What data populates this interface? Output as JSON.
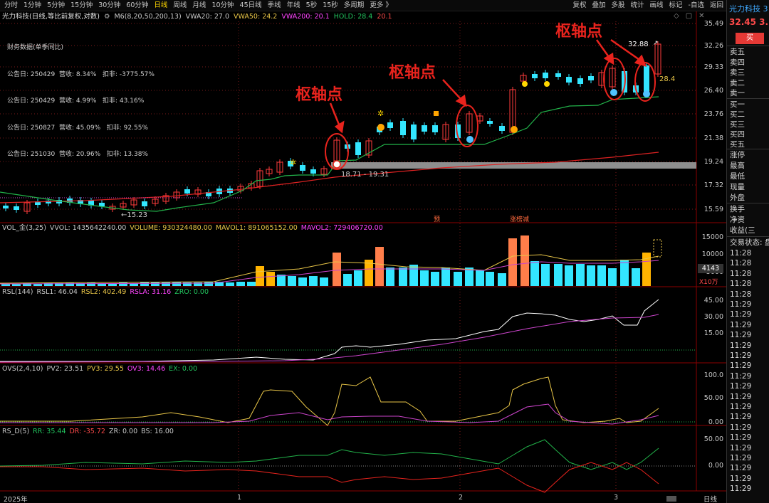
{
  "topbar": {
    "periods": [
      "分时",
      "1分钟",
      "5分钟",
      "15分钟",
      "30分钟",
      "60分钟",
      "日线",
      "周线",
      "月线",
      "10分钟",
      "45日线",
      "季线",
      "年线",
      "5秒",
      "15秒",
      "多周期",
      "更多"
    ],
    "active_period": "日线",
    "tools": [
      "复权",
      "叠加",
      "多股",
      "统计",
      "画线",
      "标记",
      "-自选",
      "返回"
    ]
  },
  "main": {
    "title": "光力科技(日线,等比前复权,对数)",
    "indicators": [
      {
        "label": "M6(8,20,50,200,13)",
        "color": "#c8c8c8"
      },
      {
        "label": "VWA20: 27.0",
        "color": "#c8c8c8"
      },
      {
        "label": "VWA50: 24.2",
        "color": "#e8c547"
      },
      {
        "label": "VWA200: 20.1",
        "color": "#ff44ff"
      },
      {
        "label": "HOLD: 28.4",
        "color": "#22c55e"
      },
      {
        "label": "20.1",
        "color": "#ff4a4a"
      }
    ],
    "financial_title": "财务数据(单季同比)",
    "financial_rows": [
      "公告日: 250429  营收: 8.34%   扣非: -3775.57%",
      "公告日: 250429  营收: 4.99%   扣非: 43.16%",
      "公告日: 250827  营收: 45.09%   扣非: 92.55%",
      "公告日: 251030  营收: 20.96%   扣非: 13.38%"
    ],
    "price_axis": [
      "35.49",
      "32.26",
      "29.33",
      "26.40",
      "23.76",
      "21.38",
      "19.24",
      "17.32",
      "15.59"
    ],
    "price_labels": {
      "low": "15.23",
      "high": "32.88",
      "hold_tag": "28.4",
      "band": "18.71 - 19.31"
    },
    "tags": {
      "yu": "预",
      "zhangting": "涨榜减"
    },
    "annotations": [
      "枢轴点",
      "枢轴点",
      "枢轴点"
    ],
    "x_axis": [
      "2025年",
      "1",
      "2",
      "3"
    ],
    "x_axis_right": "日线"
  },
  "volume": {
    "head": [
      {
        "label": "VOL_金(3,25)",
        "color": "#c8c8c8"
      },
      {
        "label": "VVOL: 1435642240.00",
        "color": "#c8c8c8"
      },
      {
        "label": "VOLUME: 930324480.00",
        "color": "#e8c547"
      },
      {
        "label": "MAVOL1: 891065152.00",
        "color": "#e8c547"
      },
      {
        "label": "MAVOL2: 729406720.00",
        "color": "#ff44ff"
      }
    ],
    "axis": [
      "15000",
      "10000",
      "5000"
    ],
    "current": "4143",
    "unit": "X10万"
  },
  "rsl": {
    "head": [
      {
        "label": "RSL(144)",
        "color": "#c8c8c8"
      },
      {
        "label": "RSL1: 46.04",
        "color": "#c8c8c8"
      },
      {
        "label": "RSL2: 402.49",
        "color": "#e8c547"
      },
      {
        "label": "RSLA: 31.16",
        "color": "#ff44ff"
      },
      {
        "label": "ZRO: 0.00",
        "color": "#22c55e"
      }
    ],
    "axis": [
      "45.00",
      "30.00",
      "15.00"
    ]
  },
  "ovs": {
    "head": [
      {
        "label": "OVS(2,4,10)",
        "color": "#c8c8c8"
      },
      {
        "label": "PV2: 23.51",
        "color": "#c8c8c8"
      },
      {
        "label": "PV3: 29.55",
        "color": "#e8c547"
      },
      {
        "label": "OV3: 14.46",
        "color": "#ff44ff"
      },
      {
        "label": "EX: 0.00",
        "color": "#22c55e"
      }
    ],
    "axis": [
      "100.0",
      "50.00",
      "0.00"
    ]
  },
  "rsd": {
    "head": [
      {
        "label": "RS_D(5)",
        "color": "#c8c8c8"
      },
      {
        "label": "RR: 35.44",
        "color": "#22c55e"
      },
      {
        "label": "DR: -35.72",
        "color": "#ff4a4a"
      },
      {
        "label": "ZR: 0.00",
        "color": "#c8c8c8"
      },
      {
        "label": "BS: 16.00",
        "color": "#c8c8c8"
      }
    ],
    "axis": [
      "50.00",
      "0.00"
    ]
  },
  "right_panel": {
    "name": "光力科技 3",
    "price": "32.45  3.1",
    "buy": "买",
    "sell_rows": [
      "卖五",
      "卖四",
      "卖三",
      "卖二",
      "卖一"
    ],
    "buy_rows": [
      "买一",
      "买二",
      "买三",
      "买四",
      "买五"
    ],
    "stats": [
      "涨停",
      "最高",
      "最低",
      "现量",
      "外盘"
    ],
    "stats2": [
      "换手",
      "净资",
      "收益(三"
    ],
    "trade_status": "交易状态: 盘",
    "times": [
      "11:28",
      "11:28",
      "11:28",
      "11:28",
      "11:28",
      "11:29",
      "11:29",
      "11:29",
      "11:29",
      "11:29",
      "11:29",
      "11:29",
      "11:29",
      "11:29",
      "11:29",
      "11:29",
      "11:29",
      "11:29",
      "11:29",
      "11:29",
      "11:29",
      "11:29",
      "11:29",
      "11:29"
    ]
  }
}
